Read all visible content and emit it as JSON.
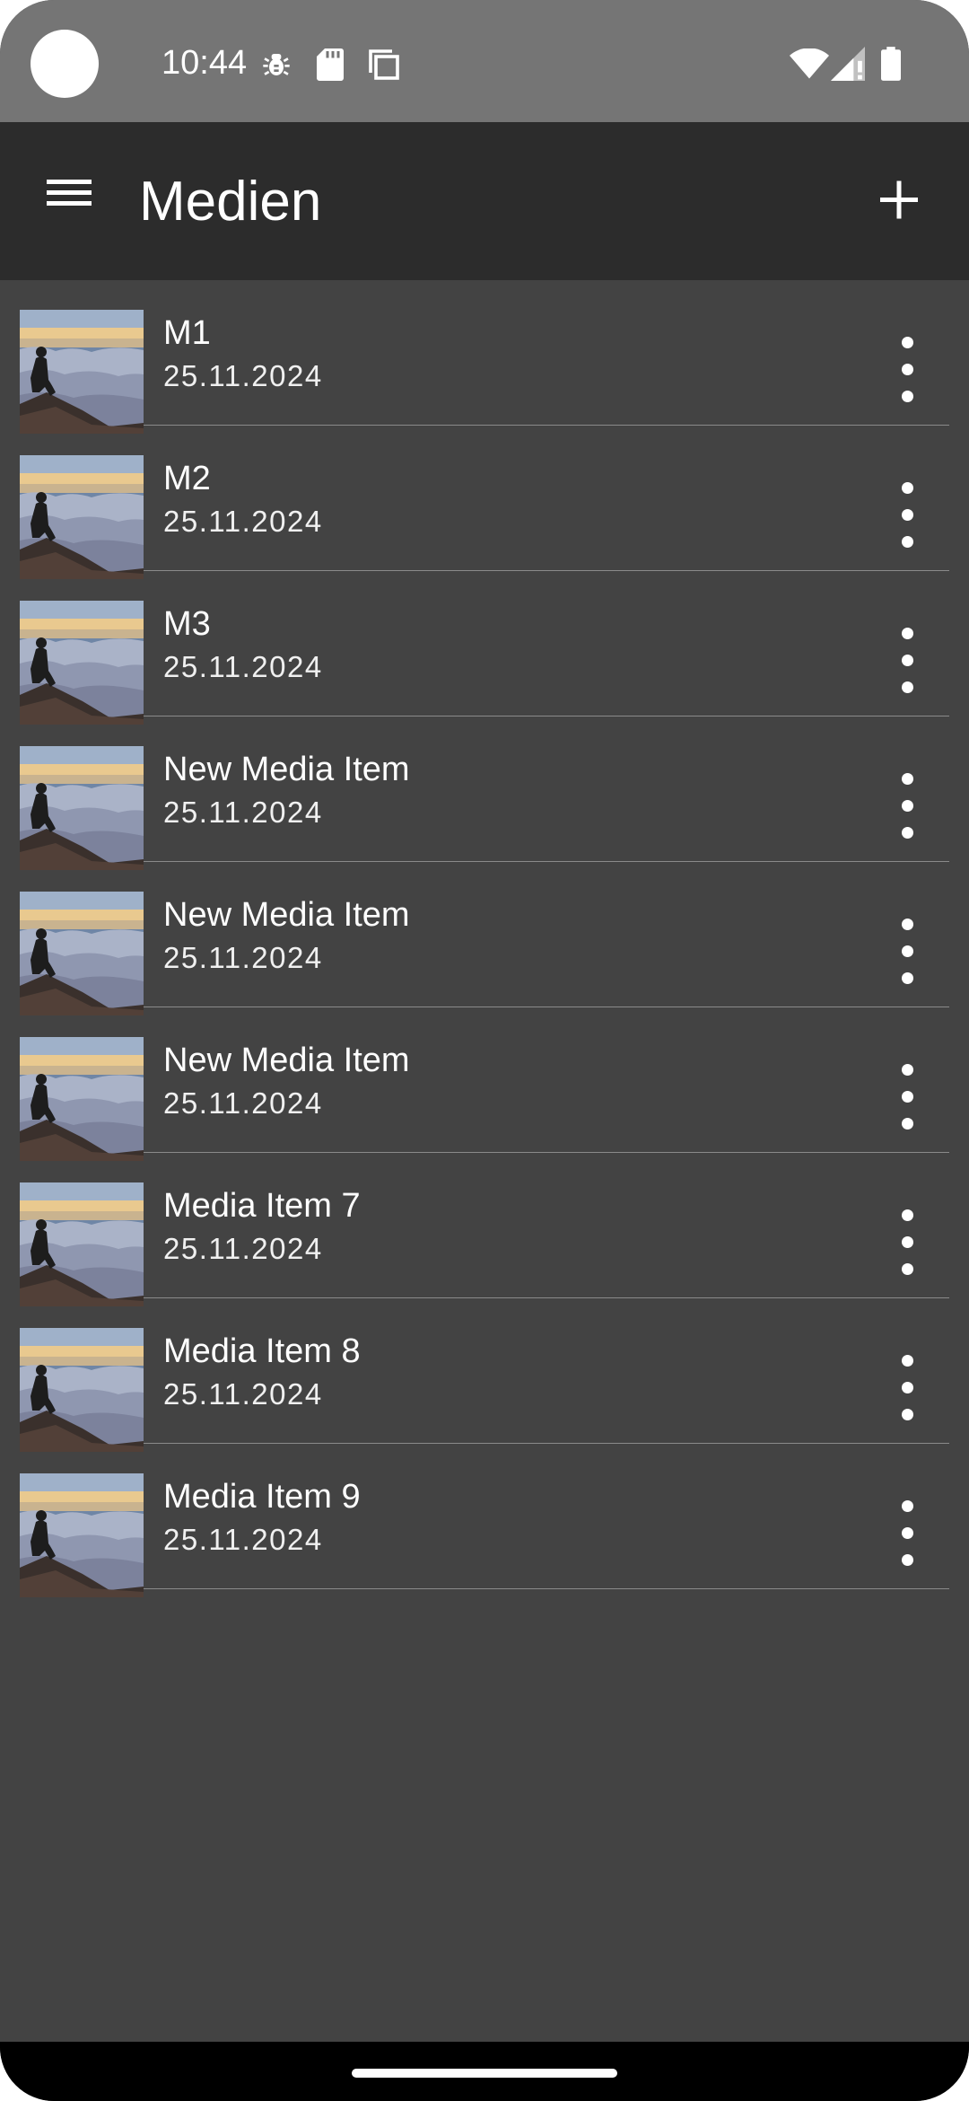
{
  "status_bar": {
    "time": "10:44",
    "icons": [
      "bug-icon",
      "sd-card-icon",
      "copy-icon",
      "wifi-icon",
      "signal-icon",
      "battery-icon"
    ]
  },
  "app_bar": {
    "title": "Medien",
    "menu_icon": "hamburger-menu-icon",
    "add_icon": "plus-icon"
  },
  "media_items": [
    {
      "title": "M1",
      "date": "25.11.2024"
    },
    {
      "title": "M2",
      "date": "25.11.2024"
    },
    {
      "title": "M3",
      "date": "25.11.2024"
    },
    {
      "title": "New Media Item",
      "date": "25.11.2024"
    },
    {
      "title": "New Media Item",
      "date": "25.11.2024"
    },
    {
      "title": "New Media Item",
      "date": "25.11.2024"
    },
    {
      "title": "Media Item 7",
      "date": "25.11.2024"
    },
    {
      "title": "Media Item 8",
      "date": "25.11.2024"
    },
    {
      "title": "Media Item 9",
      "date": "25.11.2024"
    }
  ],
  "colors": {
    "status_bar": "#757575",
    "app_bar": "#2c2c2c",
    "background": "#434343",
    "divider": "#8a8a8a",
    "text": "#ffffff"
  }
}
